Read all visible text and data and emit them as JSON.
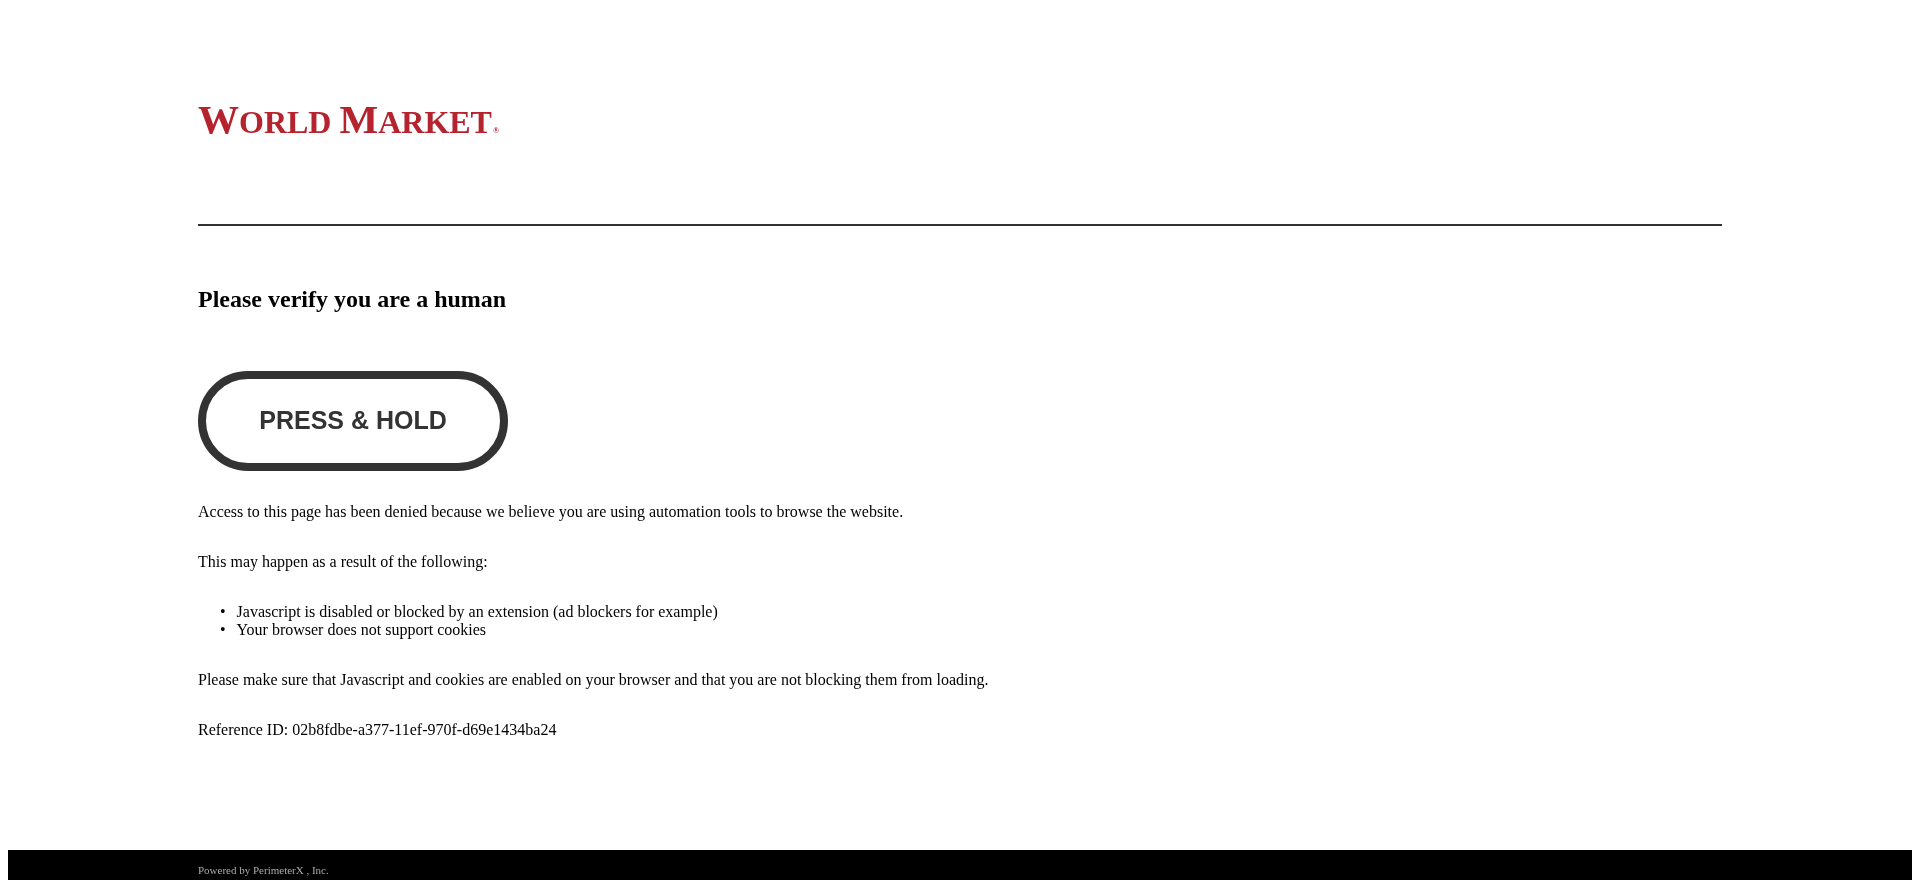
{
  "logo": {
    "text": "WORLD MARKET",
    "mark": "®"
  },
  "heading": "Please verify you are a human",
  "button": {
    "label": "PRESS & HOLD"
  },
  "paragraphs_top": [
    "Access to this page has been denied because we believe you are using automation tools to browse the website.",
    "This may happen as a result of the following:"
  ],
  "reasons": [
    {
      "bullet": "•",
      "text": "Javascript is disabled or blocked by an extension (ad blockers for example)"
    },
    {
      "bullet": "•",
      "text": "Your browser does not support cookies"
    }
  ],
  "paragraphs_bottom": [
    "Please make sure that Javascript and cookies are enabled on your browser and that you are not blocking them from loading.",
    "Reference ID: 02b8fdbe-a377-11ef-970f-d69e1434ba24"
  ],
  "footer": "Powered by PerimeterX , Inc."
}
